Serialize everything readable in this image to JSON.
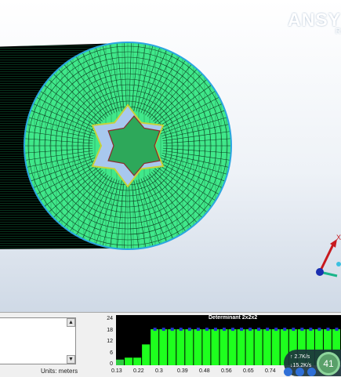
{
  "branding": {
    "logo_text": "ANSY",
    "subtitle": "R"
  },
  "status": {
    "units_label": "Units:  meters"
  },
  "histogram": {
    "title": "Determinant 2x2x2",
    "chart_data": {
      "type": "bar",
      "title": "Determinant 2x2x2",
      "y_ticks": [
        0,
        6,
        12,
        18,
        24
      ],
      "ylim": [
        0,
        24
      ],
      "x_ticks": [
        "0.13",
        "0.22",
        "0.3",
        "0.39",
        "0.48",
        "0.56",
        "0.65",
        "0.74"
      ],
      "values": [
        3,
        4,
        4,
        11,
        19,
        19,
        19,
        19,
        19,
        19,
        19,
        19,
        19,
        19,
        19,
        19,
        19,
        19,
        19,
        19,
        19,
        19,
        19,
        19,
        19,
        19
      ],
      "colors": {
        "first_bar": "#2ecc40",
        "bars": "#1eff1e",
        "background": "#000000"
      }
    }
  },
  "net_monitor": {
    "upload": "↑ 2.7K/s",
    "download": "↓15.2K/s",
    "percent": "41"
  },
  "triad": {
    "x_axis_label": "X"
  },
  "colors": {
    "mesh_face": "#40e88a",
    "mesh_lines": "#0a3a1e",
    "outer_ring": "#2aa6e0",
    "viewport_top": "#ffffff"
  }
}
